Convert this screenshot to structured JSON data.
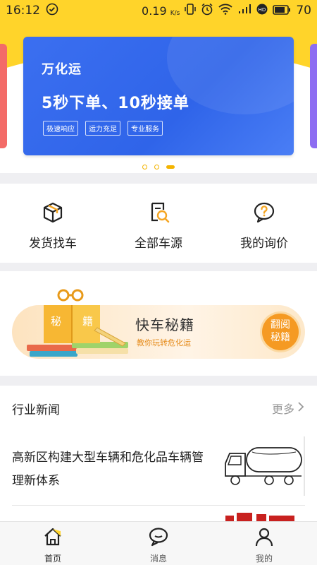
{
  "status_bar": {
    "time": "16:12",
    "network_speed": "0.19",
    "network_unit": "K/s",
    "battery": "70"
  },
  "banner": {
    "brand": "万化运",
    "headline": "5秒下单、10秒接单",
    "tags": [
      "极速响应",
      "运力充足",
      "专业服务"
    ],
    "dots": 3,
    "active_dot": 3
  },
  "quick_menu": [
    {
      "label": "发货找车",
      "icon": "package-box-icon"
    },
    {
      "label": "全部车源",
      "icon": "document-search-icon"
    },
    {
      "label": "我的询价",
      "icon": "question-bubble-icon"
    }
  ],
  "guide_card": {
    "book_char_1": "秘",
    "book_char_2": "籍",
    "title": "快车秘籍",
    "subtitle": "教你玩转危化运",
    "button_line1": "翻阅",
    "button_line2": "秘籍"
  },
  "news": {
    "section_title": "行业新闻",
    "more_label": "更多",
    "items": [
      {
        "title": "高新区构建大型车辆和危化品车辆管理新体系",
        "thumb": "tanker-truck-sketch"
      }
    ]
  },
  "tabbar": {
    "tabs": [
      {
        "label": "首页",
        "icon": "home-icon",
        "active": true
      },
      {
        "label": "消息",
        "icon": "chat-bubble-icon",
        "active": false
      },
      {
        "label": "我的",
        "icon": "user-icon",
        "active": false
      }
    ]
  },
  "colors": {
    "brand_yellow": "#ffd42a",
    "banner_blue": "#2f64e9",
    "accent_orange": "#f59a23"
  }
}
